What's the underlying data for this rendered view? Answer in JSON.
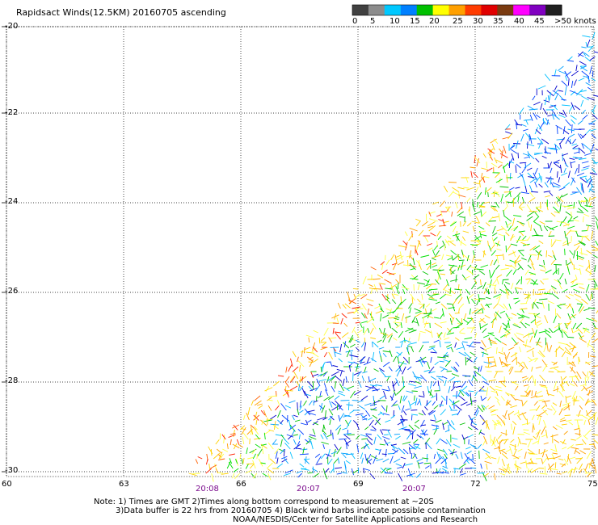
{
  "title": "Rapidsact Winds(12.5KM) 20160705 ascending",
  "legend": {
    "labels": [
      "0",
      "5",
      "10",
      "15",
      "20",
      "25",
      "30",
      "35",
      "40",
      "45",
      ">50 knots"
    ],
    "colors": [
      "#404040",
      "#8c8c8c",
      "#00c8ff",
      "#0080ff",
      "#00c000",
      "#ffff00",
      "#ffa000",
      "#ff3c00",
      "#e00000",
      "#7a3a10",
      "#ff00ff",
      "#8000c0",
      "#202020"
    ]
  },
  "axes": {
    "lat_labels": [
      "-20",
      "-22",
      "-24",
      "-26",
      "-28",
      "-30"
    ],
    "lon_labels": [
      "60",
      "63",
      "66",
      "69",
      "72",
      "75"
    ],
    "time_labels": [
      "20:08",
      "20:07",
      "20:07"
    ]
  },
  "notes": [
    "Note: 1) Times are GMT 2)Times along bottom correspond to measurement at ~20S",
    "3)Data buffer is 22 hrs from 20160705 4) Black wind barbs indicate possible contamination",
    "NOAA/NESDIS/Center for Satellite Applications and Research"
  ]
}
